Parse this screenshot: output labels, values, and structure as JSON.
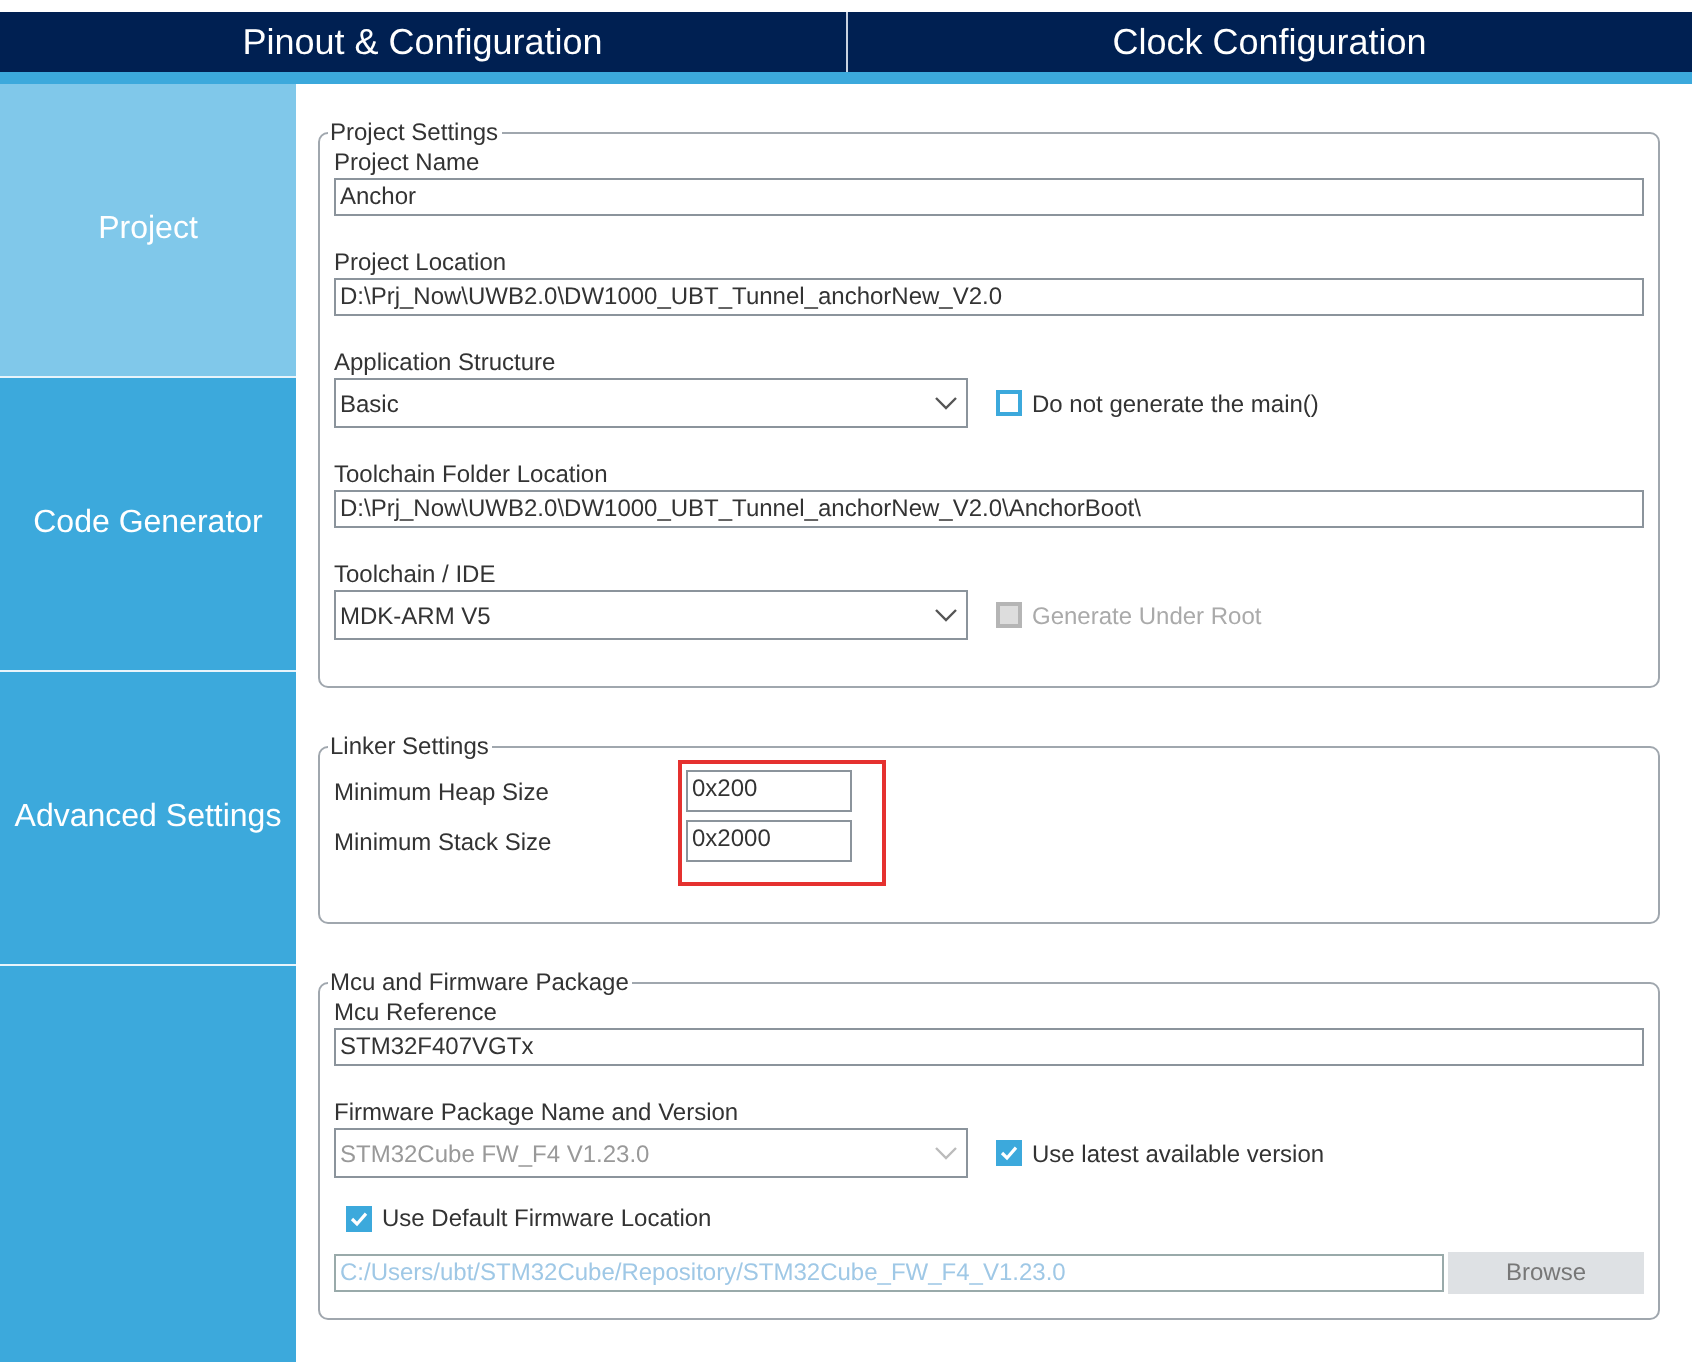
{
  "tabs": [
    {
      "label": "Pinout & Configuration",
      "selected": false
    },
    {
      "label": "Clock Configuration",
      "selected": false
    }
  ],
  "sidebar": {
    "items": [
      {
        "label": "Project",
        "selected": true
      },
      {
        "label": "Code Generator",
        "selected": false
      },
      {
        "label": "Advanced Settings",
        "selected": false
      }
    ]
  },
  "sections": [
    {
      "title": "Project Settings",
      "rows": [
        {
          "kind": "field",
          "label": "Project Name",
          "value": "Anchor"
        },
        {
          "kind": "field",
          "label": "Project Location",
          "value": "D:\\Prj_Now\\UWB2.0\\DW1000_UBT_Tunnel_anchorNew_V2.0"
        },
        {
          "kind": "select",
          "label": "Application Structure",
          "value": "Basic",
          "disabled": false,
          "option": {
            "label": "Do not generate the main()",
            "checked": false,
            "disabled": false
          }
        },
        {
          "kind": "field",
          "label": "Toolchain Folder Location",
          "value": "D:\\Prj_Now\\UWB2.0\\DW1000_UBT_Tunnel_anchorNew_V2.0\\AnchorBoot\\"
        },
        {
          "kind": "select",
          "label": "Toolchain / IDE",
          "value": "MDK-ARM V5",
          "disabled": false,
          "option": {
            "label": "Generate Under Root",
            "checked": false,
            "disabled": true
          }
        }
      ]
    },
    {
      "title": "Linker Settings",
      "highlighted": true,
      "rows": [
        {
          "kind": "inline",
          "label": "Minimum Heap Size",
          "value": "0x200"
        },
        {
          "kind": "inline",
          "label": "Minimum Stack Size",
          "value": "0x2000"
        }
      ]
    },
    {
      "title": "Mcu and Firmware Package",
      "rows": [
        {
          "kind": "field",
          "label": "Mcu Reference",
          "value": "STM32F407VGTx"
        },
        {
          "kind": "select",
          "label": "Firmware Package Name and Version",
          "value": "STM32Cube FW_F4 V1.23.0",
          "disabled": true,
          "option": {
            "label": "Use latest available version",
            "checked": true,
            "disabled": false
          }
        },
        {
          "kind": "check",
          "label": "Use Default Firmware Location",
          "checked": true,
          "disabled": false
        },
        {
          "kind": "path",
          "value": "C:/Users/ubt/STM32Cube/Repository/STM32Cube_FW_F4_V1.23.0",
          "disabled": true,
          "button": "Browse"
        }
      ]
    }
  ]
}
